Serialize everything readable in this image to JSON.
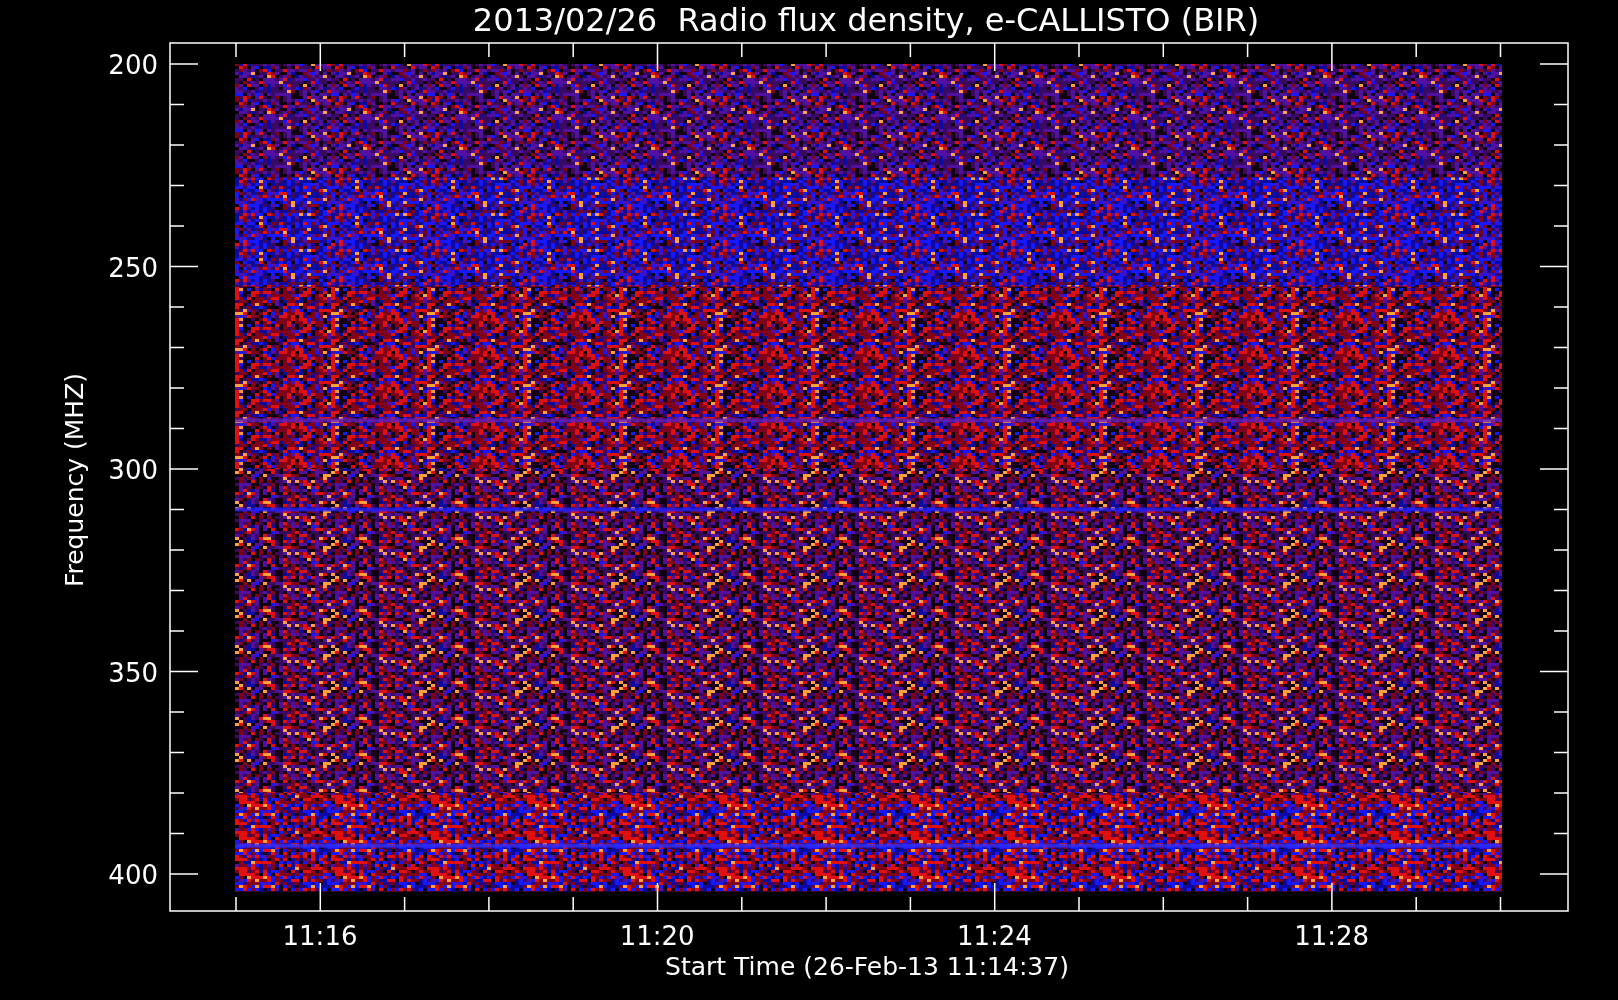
{
  "title": "2013/02/26  Radio flux density, e-CALLISTO (BIR)",
  "y_axis": {
    "label": "Frequency (MHZ)",
    "ticks": [
      "200",
      "250",
      "300",
      "350",
      "400"
    ]
  },
  "x_axis": {
    "label": "Start Time (26-Feb-13 11:14:37)",
    "ticks": [
      "11:16",
      "11:20",
      "11:24",
      "11:28"
    ]
  }
}
